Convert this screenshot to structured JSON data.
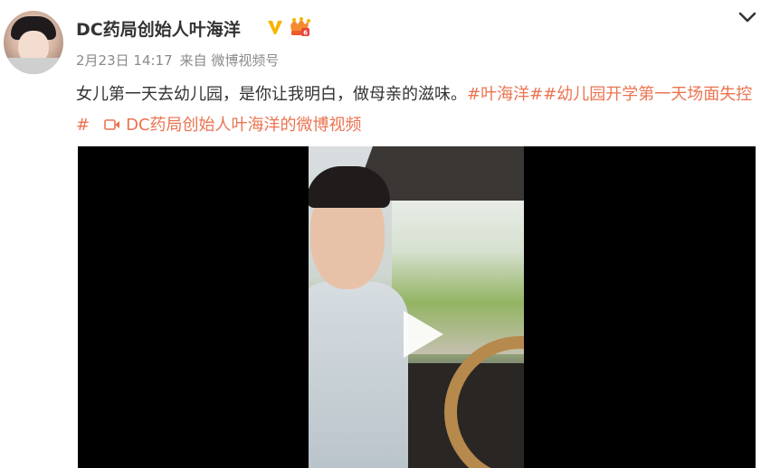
{
  "post": {
    "username": "DC药局创始人叶海洋",
    "date": "2月23日 14:17",
    "source": "来自 微博视频号",
    "text": "女儿第一天去幼儿园，是你让我明白，做母亲的滋味。",
    "hashtags": [
      "#叶海洋#",
      "#幼儿园开学第一天场面失控#"
    ],
    "video_link_text": "DC药局创始人叶海洋的微博视频"
  },
  "icons": {
    "verified": "verified-v-icon",
    "vip": "vip-crown-icon",
    "expand": "chevron-down-icon",
    "video_link": "video-camera-icon",
    "play": "play-icon"
  },
  "colors": {
    "username": "#333333",
    "meta": "#8a8a8a",
    "link": "#eb7350",
    "verified": "#f7b500",
    "video_background": "#000000"
  }
}
